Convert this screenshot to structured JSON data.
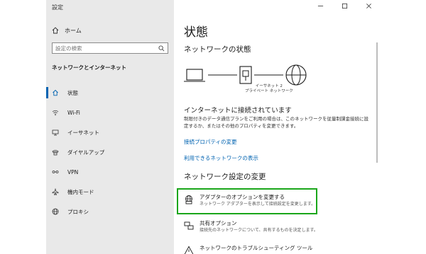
{
  "window": {
    "title": "設定",
    "controls": [
      "minimize-icon",
      "maximize-icon",
      "close-icon"
    ]
  },
  "sidebar": {
    "home_label": "ホーム",
    "search_placeholder": "設定の検索",
    "section_label": "ネットワークとインターネット",
    "items": [
      {
        "label": "状態",
        "icon": "home-status-icon",
        "active": true
      },
      {
        "label": "Wi-Fi",
        "icon": "wifi-icon",
        "active": false
      },
      {
        "label": "イーサネット",
        "icon": "ethernet-icon",
        "active": false
      },
      {
        "label": "ダイヤルアップ",
        "icon": "dialup-icon",
        "active": false
      },
      {
        "label": "VPN",
        "icon": "vpn-icon",
        "active": false
      },
      {
        "label": "機内モード",
        "icon": "airplane-icon",
        "active": false
      },
      {
        "label": "プロキシ",
        "icon": "globe-icon",
        "active": false
      }
    ]
  },
  "main": {
    "page_title": "状態",
    "network_status_heading": "ネットワークの状態",
    "network_name": "イーサネット 2",
    "network_type": "プライベート ネットワーク",
    "connected_heading": "インターネットに接続されています",
    "connected_desc": "制限付きのデータ通信プランをご利用の場合は、このネットワークを従量制課金接続に設定するか、またはその他のプロパティを変更できます。",
    "link_change_properties": "接続プロパティの変更",
    "link_available_networks": "利用できるネットワークの表示",
    "change_settings_heading": "ネットワーク設定の変更",
    "options": [
      {
        "title": "アダプターのオプションを変更する",
        "desc": "ネットワーク アダプターを表示して接続設定を変更します。",
        "icon": "adapter-icon"
      },
      {
        "title": "共有オプション",
        "desc": "接続先のネットワークについて、共有するものを決定します。",
        "icon": "sharing-icon"
      },
      {
        "title": "ネットワークのトラブルシューティング ツール",
        "desc": "",
        "icon": "warning-icon"
      }
    ]
  },
  "colors": {
    "sidebar_bg": "#e9e9e9",
    "accent": "#0063b1",
    "highlight": "#1aa61a"
  }
}
